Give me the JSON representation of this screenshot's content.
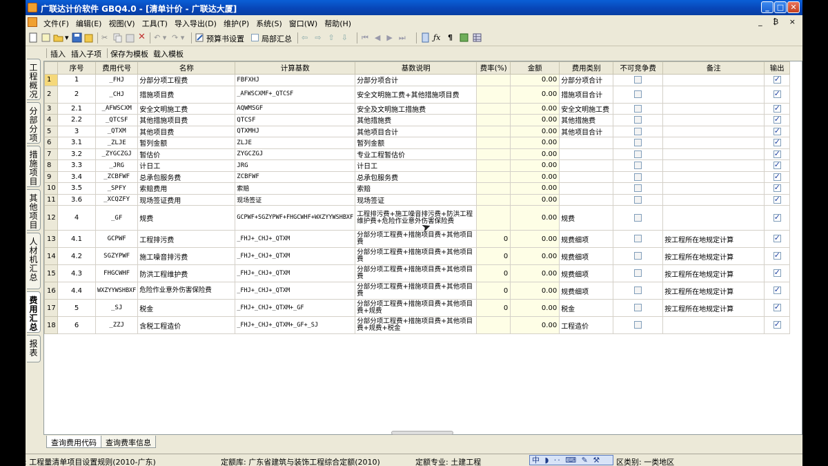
{
  "window": {
    "title": "广联达计价软件 GBQ4.0 - [清单计价 - 广联达大厦]",
    "min_label": "_",
    "max_label": "□",
    "close_label": "✕"
  },
  "menu": {
    "items": [
      "文件(F)",
      "编辑(E)",
      "视图(V)",
      "工具(T)",
      "导入导出(D)",
      "维护(P)",
      "系统(S)",
      "窗口(W)",
      "帮助(H)"
    ],
    "mdi_controls": "_ ₿ ×"
  },
  "toolbar": {
    "budget_settings": "预算书设置",
    "partial_summary": "局部汇总"
  },
  "subtoolbar": {
    "insert": "插入",
    "insert_child": "插入子项",
    "save_as_template": "保存为模板",
    "load_template": "载入模板"
  },
  "side_tabs": [
    {
      "label": "工程概况"
    },
    {
      "label": "分部分项"
    },
    {
      "label": "措施项目"
    },
    {
      "label": "其他项目"
    },
    {
      "label": "人材机汇总"
    },
    {
      "label": "费用汇总"
    },
    {
      "label": "报表"
    }
  ],
  "grid": {
    "headers": [
      "序号",
      "费用代号",
      "名称",
      "计算基数",
      "基数说明",
      "费率(%)",
      "金额",
      "费用类别",
      "不可竞争费",
      "备注",
      "输出"
    ],
    "rows": [
      {
        "n": "1",
        "seq": "1",
        "code": "_FHJ",
        "name": "分部分项工程费",
        "base": "FBFXHJ",
        "desc": "分部分项合计",
        "rate": "",
        "amount": "0.00",
        "cat": "分部分项合计",
        "nc": false,
        "note": "",
        "out": true
      },
      {
        "n": "2",
        "seq": "2",
        "code": "_CHJ",
        "name": "措施项目费",
        "base": "_AFWSCXMF+_QTCSF",
        "desc": "安全文明施工费+其他措施项目费",
        "rate": "",
        "amount": "0.00",
        "cat": "措施项目合计",
        "nc": false,
        "note": "",
        "out": true
      },
      {
        "n": "3",
        "seq": "2.1",
        "code": "_AFWSCXM",
        "name": "安全文明施工费",
        "base": "AQWMSGF",
        "desc": "安全及文明施工措施费",
        "rate": "",
        "amount": "0.00",
        "cat": "安全文明施工费",
        "nc": false,
        "note": "",
        "out": true
      },
      {
        "n": "4",
        "seq": "2.2",
        "code": "_QTCSF",
        "name": "其他措施项目费",
        "base": "QTCSF",
        "desc": "其他措施费",
        "rate": "",
        "amount": "0.00",
        "cat": "其他措施费",
        "nc": false,
        "note": "",
        "out": true
      },
      {
        "n": "5",
        "seq": "3",
        "code": "_QTXM",
        "name": "其他项目费",
        "base": "QTXMHJ",
        "desc": "其他项目合计",
        "rate": "",
        "amount": "0.00",
        "cat": "其他项目合计",
        "nc": false,
        "note": "",
        "out": true
      },
      {
        "n": "6",
        "seq": "3.1",
        "code": "_ZLJE",
        "name": "暂列金额",
        "base": "ZLJE",
        "desc": "暂列金额",
        "rate": "",
        "amount": "0.00",
        "cat": "",
        "nc": false,
        "note": "",
        "out": true
      },
      {
        "n": "7",
        "seq": "3.2",
        "code": "_ZYGCZGJ",
        "name": "暂估价",
        "base": "ZYGCZGJ",
        "desc": "专业工程暂估价",
        "rate": "",
        "amount": "0.00",
        "cat": "",
        "nc": false,
        "note": "",
        "out": true
      },
      {
        "n": "8",
        "seq": "3.3",
        "code": "_JRG",
        "name": "计日工",
        "base": "JRG",
        "desc": "计日工",
        "rate": "",
        "amount": "0.00",
        "cat": "",
        "nc": false,
        "note": "",
        "out": true
      },
      {
        "n": "9",
        "seq": "3.4",
        "code": "_ZCBFWF",
        "name": "总承包服务费",
        "base": "ZCBFWF",
        "desc": "总承包服务费",
        "rate": "",
        "amount": "0.00",
        "cat": "",
        "nc": false,
        "note": "",
        "out": true
      },
      {
        "n": "10",
        "seq": "3.5",
        "code": "_SPFY",
        "name": "索赔费用",
        "base": "索赔",
        "desc": "索赔",
        "rate": "",
        "amount": "0.00",
        "cat": "",
        "nc": false,
        "note": "",
        "out": true
      },
      {
        "n": "11",
        "seq": "3.6",
        "code": "_XCQZFY",
        "name": "现场签证费用",
        "base": "现场签证",
        "desc": "现场签证",
        "rate": "",
        "amount": "0.00",
        "cat": "",
        "nc": false,
        "note": "",
        "out": true
      },
      {
        "n": "12",
        "seq": "4",
        "code": "_GF",
        "name": "规费",
        "base": "GCPWF+SGZYPWF+FHGCWHF+WXZYYWSHBXF",
        "desc": "工程排污费+施工噪音排污费+防洪工程维护费+危险作业意外伤害保险费",
        "rate": "",
        "amount": "0.00",
        "cat": "规费",
        "nc": false,
        "note": "",
        "out": true
      },
      {
        "n": "13",
        "seq": "4.1",
        "code": "GCPWF",
        "name": "工程排污费",
        "base": "_FHJ+_CHJ+_QTXM",
        "desc": "分部分项工程费+措施项目费+其他项目费",
        "rate": "0",
        "amount": "0.00",
        "cat": "规费细项",
        "nc": false,
        "note": "按工程所在地规定计算",
        "out": true
      },
      {
        "n": "14",
        "seq": "4.2",
        "code": "SGZYPWF",
        "name": "施工噪音排污费",
        "base": "_FHJ+_CHJ+_QTXM",
        "desc": "分部分项工程费+措施项目费+其他项目费",
        "rate": "0",
        "amount": "0.00",
        "cat": "规费细项",
        "nc": false,
        "note": "按工程所在地规定计算",
        "out": true
      },
      {
        "n": "15",
        "seq": "4.3",
        "code": "FHGCWHF",
        "name": "防洪工程维护费",
        "base": "_FHJ+_CHJ+_QTXM",
        "desc": "分部分项工程费+措施项目费+其他项目费",
        "rate": "0",
        "amount": "0.00",
        "cat": "规费细项",
        "nc": false,
        "note": "按工程所在地规定计算",
        "out": true
      },
      {
        "n": "16",
        "seq": "4.4",
        "code": "WXZYYWSHBXF",
        "name": "危险作业意外伤害保险费",
        "base": "_FHJ+_CHJ+_QTXM",
        "desc": "分部分项工程费+措施项目费+其他项目费",
        "rate": "0",
        "amount": "0.00",
        "cat": "规费细项",
        "nc": false,
        "note": "按工程所在地规定计算",
        "out": true
      },
      {
        "n": "17",
        "seq": "5",
        "code": "_SJ",
        "name": "税金",
        "base": "_FHJ+_CHJ+_QTXM+_GF",
        "desc": "分部分项工程费+措施项目费+其他项目费+规费",
        "rate": "0",
        "amount": "0.00",
        "cat": "税金",
        "nc": false,
        "note": "按工程所在地规定计算",
        "out": true
      },
      {
        "n": "18",
        "seq": "6",
        "code": "_ZZJ",
        "name": "含税工程造价",
        "base": "_FHJ+_CHJ+_QTXM+_GF+_SJ",
        "desc": "分部分项工程费+措施项目费+其他项目费+规费+税金",
        "rate": "",
        "amount": "0.00",
        "cat": "工程造价",
        "nc": false,
        "note": "",
        "out": true
      }
    ]
  },
  "bottom_tabs": {
    "query_fee_code": "查询费用代码",
    "query_rate_info": "查询费率信息"
  },
  "status": {
    "bill_lib": "清单库: 工程量清单项目设置规则(2010-广东)",
    "quota_lib": "定额库: 广东省建筑与装饰工程综合定额(2010)",
    "quota_major": "定额专业: 土建工程",
    "region": "区类别: 一类地区",
    "ime": "中 ◗ ·· ⌨ ✎ ⚒"
  }
}
